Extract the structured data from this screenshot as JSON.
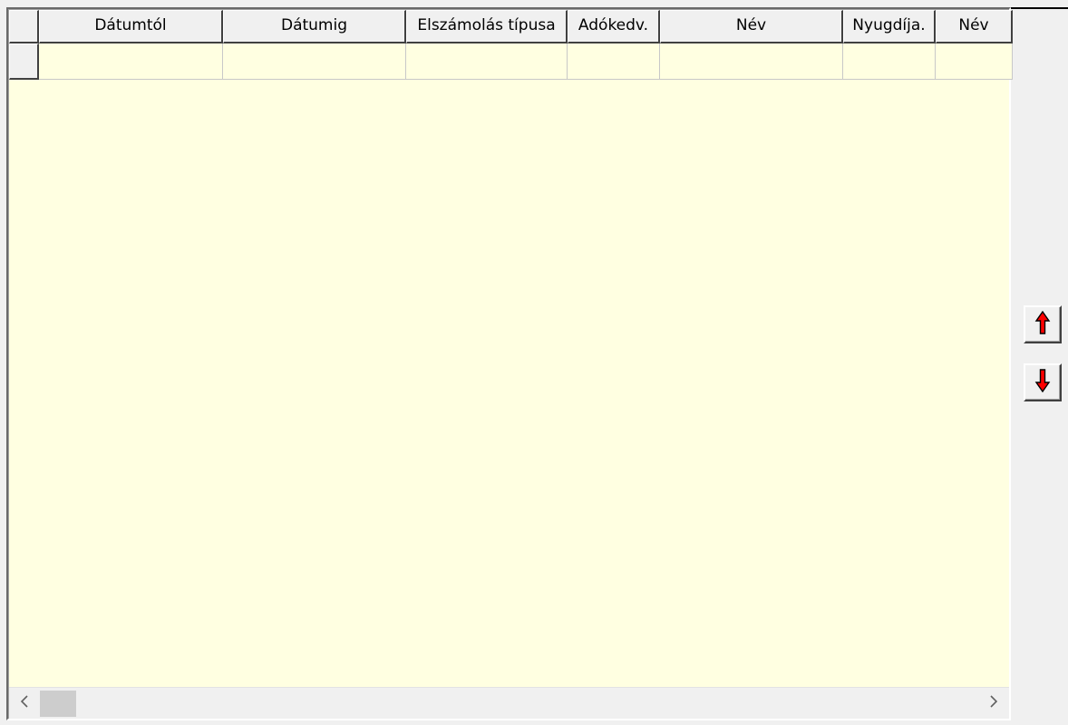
{
  "table": {
    "columns": [
      {
        "key": "datumtol",
        "label": "Dátumtól"
      },
      {
        "key": "datumig",
        "label": "Dátumig"
      },
      {
        "key": "elszamolas",
        "label": "Elszámolás típusa"
      },
      {
        "key": "adokedv",
        "label": "Adókedv."
      },
      {
        "key": "nev1",
        "label": "Név"
      },
      {
        "key": "nyugdija",
        "label": "Nyugdíja."
      },
      {
        "key": "nev2",
        "label": "Név"
      }
    ],
    "rows": [
      [
        "",
        "",
        "",
        "",
        "",
        "",
        ""
      ]
    ]
  },
  "icons": {
    "move_up": "red-up-arrow-icon",
    "move_down": "red-down-arrow-icon",
    "scroll_left": "chevron-left-icon",
    "scroll_right": "chevron-right-icon"
  },
  "colors": {
    "grid_background": "#ffffe1",
    "arrow_red": "#ff0000"
  }
}
